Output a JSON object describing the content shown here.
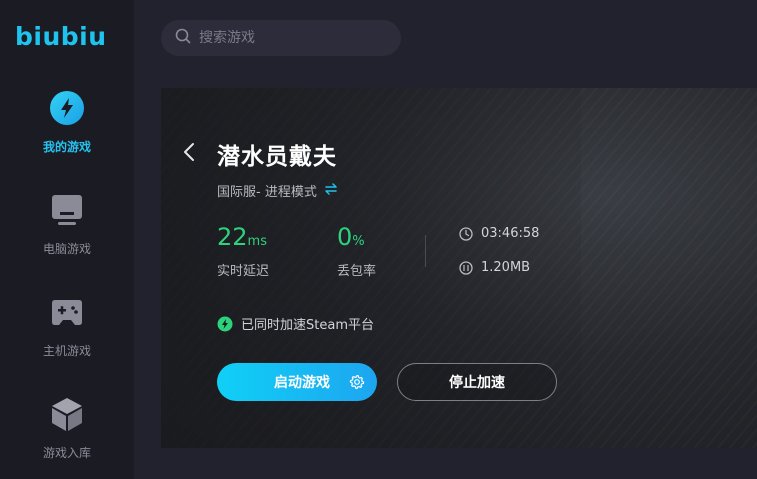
{
  "app": {
    "logo": "biubiu"
  },
  "sidebar": {
    "items": [
      {
        "label": "我的游戏",
        "icon": "lightning-icon",
        "active": true
      },
      {
        "label": "电脑游戏",
        "icon": "monitor-icon",
        "active": false
      },
      {
        "label": "主机游戏",
        "icon": "gamepad-icon",
        "active": false
      },
      {
        "label": "游戏入库",
        "icon": "cube-icon",
        "active": false
      }
    ]
  },
  "search": {
    "placeholder": "搜索游戏"
  },
  "game": {
    "title": "潜水员戴夫",
    "server": "国际服- 进程模式",
    "latency": {
      "value": "22",
      "unit": "ms",
      "label": "实时延迟"
    },
    "packet_loss": {
      "value": "0",
      "unit": "%",
      "label": "丢包率"
    },
    "duration": "03:46:58",
    "traffic": "1.20MB",
    "steam_notice": "已同时加速Steam平台",
    "start_button": "启动游戏",
    "stop_button": "停止加速"
  },
  "colors": {
    "accent": "#1ec4ee",
    "stat_green": "#2dd37c",
    "sidebar_bg": "#1b1b24",
    "main_bg": "#22222e"
  }
}
